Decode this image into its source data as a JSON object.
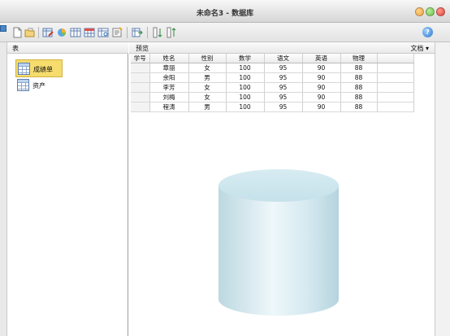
{
  "window": {
    "title": "未命名3 - 数据库",
    "controls": {
      "minimize_color": "#f2a43c",
      "maximize_color": "#6cc04a",
      "close_color": "#e0443a"
    }
  },
  "toolbar": {
    "icons": [
      "new-document-icon",
      "open-folder-icon",
      "edit-table-icon",
      "chart-icon",
      "columns-icon",
      "table-props-icon",
      "query-icon",
      "form-icon",
      "export-icon",
      "sort-asc-icon",
      "sort-desc-icon"
    ],
    "help_label": "?"
  },
  "left_panel": {
    "header": "表",
    "items": [
      {
        "label": "成绩单",
        "selected": true
      },
      {
        "label": "资产",
        "selected": false
      }
    ]
  },
  "right_panel": {
    "header": "预览",
    "doc_button": "文档 ▾"
  },
  "table": {
    "columns": [
      "学号",
      "姓名",
      "性别",
      "数学",
      "语文",
      "英语",
      "物理",
      ""
    ],
    "rows": [
      [
        "",
        "章丽",
        "女",
        "100",
        "95",
        "90",
        "88",
        ""
      ],
      [
        "",
        "余阳",
        "男",
        "100",
        "95",
        "90",
        "88",
        ""
      ],
      [
        "",
        "李芳",
        "女",
        "100",
        "95",
        "90",
        "88",
        ""
      ],
      [
        "",
        "刘梅",
        "女",
        "100",
        "95",
        "90",
        "88",
        ""
      ],
      [
        "",
        "程涛",
        "男",
        "100",
        "95",
        "90",
        "88",
        ""
      ]
    ]
  },
  "graphic": {
    "type": "database-cylinder-icon",
    "color": "#cde6ee"
  }
}
